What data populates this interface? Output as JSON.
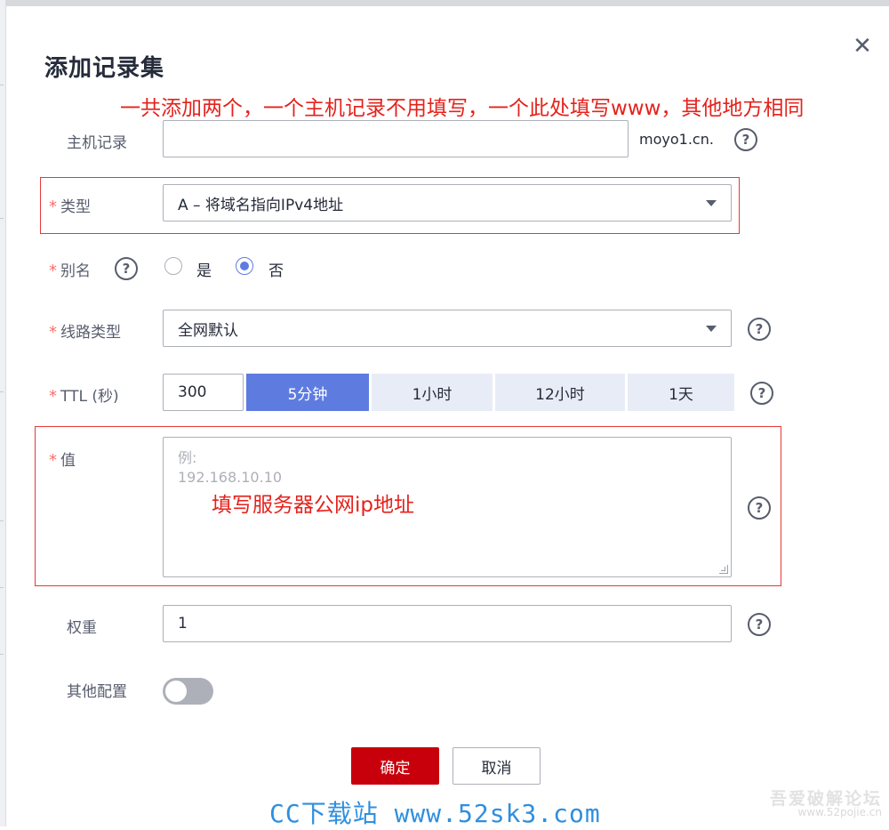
{
  "dialog": {
    "title": "添加记录集",
    "close_glyph": "✕"
  },
  "annotations": {
    "top_note": "一共添加两个，一个主机记录不用填写，一个此处填写www，其他地方相同",
    "value_note": "填写服务器公网ip地址"
  },
  "form": {
    "host": {
      "label": "主机记录",
      "value": "",
      "suffix": "moyo1.cn."
    },
    "type": {
      "label": "类型",
      "value": "A – 将域名指向IPv4地址"
    },
    "alias": {
      "label": "别名",
      "options": [
        "是",
        "否"
      ],
      "selected": "否"
    },
    "line": {
      "label": "线路类型",
      "value": "全网默认"
    },
    "ttl": {
      "label": "TTL (秒)",
      "value": "300",
      "presets": [
        "5分钟",
        "1小时",
        "12小时",
        "1天"
      ],
      "active_preset": "5分钟"
    },
    "value": {
      "label": "值",
      "placeholder_line1": "例:",
      "placeholder_line2": "192.168.10.10"
    },
    "weight": {
      "label": "权重",
      "value": "1"
    },
    "other": {
      "label": "其他配置",
      "enabled": false
    }
  },
  "required_mark": "*",
  "help_glyph": "?",
  "buttons": {
    "confirm": "确定",
    "cancel": "取消"
  },
  "watermarks": {
    "site": "CC下载站 www.52sk3.com",
    "corner_title": "吾爱破解论坛",
    "corner_url": "www.52pojie.cn"
  },
  "colors": {
    "primary": "#c7000b",
    "accent": "#5e7ce0",
    "annotation": "#e5221c",
    "required": "#f66f6a"
  }
}
